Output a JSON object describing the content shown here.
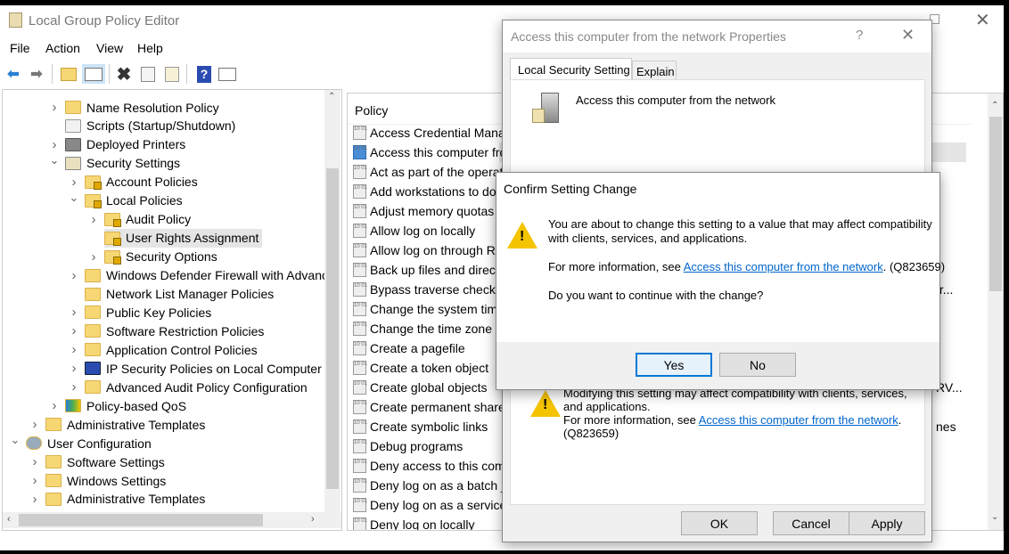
{
  "window": {
    "title": "Local Group Policy Editor",
    "menu": [
      "File",
      "Action",
      "View",
      "Help"
    ]
  },
  "toolbar": {
    "icons": [
      "back-arrow-icon",
      "forward-arrow-icon",
      "up-folder-icon",
      "show-hide-tree-icon",
      "delete-icon",
      "properties-icon",
      "export-list-icon",
      "help-icon",
      "show-action-pane-icon"
    ]
  },
  "tree": [
    {
      "label": "Name Resolution Policy",
      "level": 3,
      "arrow": "right",
      "icon": "folder"
    },
    {
      "label": "Scripts (Startup/Shutdown)",
      "level": 3,
      "arrow": "",
      "icon": "script"
    },
    {
      "label": "Deployed Printers",
      "level": 3,
      "arrow": "right",
      "icon": "printer"
    },
    {
      "label": "Security Settings",
      "level": 3,
      "arrow": "down",
      "icon": "security"
    },
    {
      "label": "Account Policies",
      "level": 4,
      "arrow": "right",
      "icon": "folder-lock"
    },
    {
      "label": "Local Policies",
      "level": 4,
      "arrow": "down",
      "icon": "folder-lock"
    },
    {
      "label": "Audit Policy",
      "level": 5,
      "arrow": "right",
      "icon": "folder-lock"
    },
    {
      "label": "User Rights Assignment",
      "level": 5,
      "arrow": "",
      "icon": "folder-lock",
      "selected": true
    },
    {
      "label": "Security Options",
      "level": 5,
      "arrow": "right",
      "icon": "folder-lock"
    },
    {
      "label": "Windows Defender Firewall with Advance",
      "level": 4,
      "arrow": "right",
      "icon": "folder"
    },
    {
      "label": "Network List Manager Policies",
      "level": 4,
      "arrow": "",
      "icon": "folder"
    },
    {
      "label": "Public Key Policies",
      "level": 4,
      "arrow": "right",
      "icon": "folder"
    },
    {
      "label": "Software Restriction Policies",
      "level": 4,
      "arrow": "right",
      "icon": "folder"
    },
    {
      "label": "Application Control Policies",
      "level": 4,
      "arrow": "right",
      "icon": "folder"
    },
    {
      "label": "IP Security Policies on Local Computer",
      "level": 4,
      "arrow": "right",
      "icon": "ipsec"
    },
    {
      "label": "Advanced Audit Policy Configuration",
      "level": 4,
      "arrow": "right",
      "icon": "folder"
    },
    {
      "label": "Policy-based QoS",
      "level": 3,
      "arrow": "right",
      "icon": "qos"
    },
    {
      "label": "Administrative Templates",
      "level": 2,
      "arrow": "right",
      "icon": "folder"
    },
    {
      "label": "User Configuration",
      "level": 1,
      "arrow": "down",
      "icon": "user"
    },
    {
      "label": "Software Settings",
      "level": 2,
      "arrow": "right",
      "icon": "folder"
    },
    {
      "label": "Windows Settings",
      "level": 2,
      "arrow": "right",
      "icon": "folder"
    },
    {
      "label": "Administrative Templates",
      "level": 2,
      "arrow": "right",
      "icon": "folder"
    }
  ],
  "list": {
    "header": "Policy",
    "rows": [
      "Access Credential Manag",
      "Access this computer fro",
      "Act as part of the operati",
      "Add workstations to do",
      "Adjust memory quotas",
      "Allow log on locally",
      "Allow log on through R",
      "Back up files and direct",
      "Bypass traverse checkin",
      "Change the system tim",
      "Change the time zone",
      "Create a pagefile",
      "Create a token object",
      "Create global objects",
      "Create permanent shared",
      "Create symbolic links",
      "Debug programs",
      "Deny access to this comp",
      "Deny log on as a batch jo",
      "Deny log on as a service",
      "Deny log on locally"
    ],
    "selected_index": 1,
    "setting_fragments": [
      {
        "row": 8,
        "text": "tr..."
      },
      {
        "row": 13,
        "text": "RV..."
      },
      {
        "row": 15,
        "text": "nes"
      }
    ]
  },
  "properties": {
    "title": "Access this computer from the network Properties",
    "help": "?",
    "tabs": [
      "Local Security Setting",
      "Explain"
    ],
    "active_tab": 0,
    "policy_name": "Access this computer from the network",
    "warning_line1": "Modifying this setting may affect compatibility with clients, services,",
    "warning_line2": "and applications.",
    "more_prefix": "For more information, see ",
    "link": "Access this computer from the network",
    "more_suffix": ".",
    "kb": "(Q823659)",
    "buttons": {
      "ok": "OK",
      "cancel": "Cancel",
      "apply": "Apply"
    }
  },
  "confirm": {
    "title": "Confirm Setting Change",
    "line1": "You are about to change this setting to a value that may affect compatibility",
    "line2": "with clients, services, and applications.",
    "more_prefix": "For more information, see ",
    "link": "Access this computer from the network",
    "more_suffix": ". (Q823659)",
    "question": "Do you want to continue with the change?",
    "yes": "Yes",
    "no": "No"
  },
  "colors": {
    "accent": "#0078d7",
    "link": "#0066cc",
    "folder": "#f7d774"
  }
}
